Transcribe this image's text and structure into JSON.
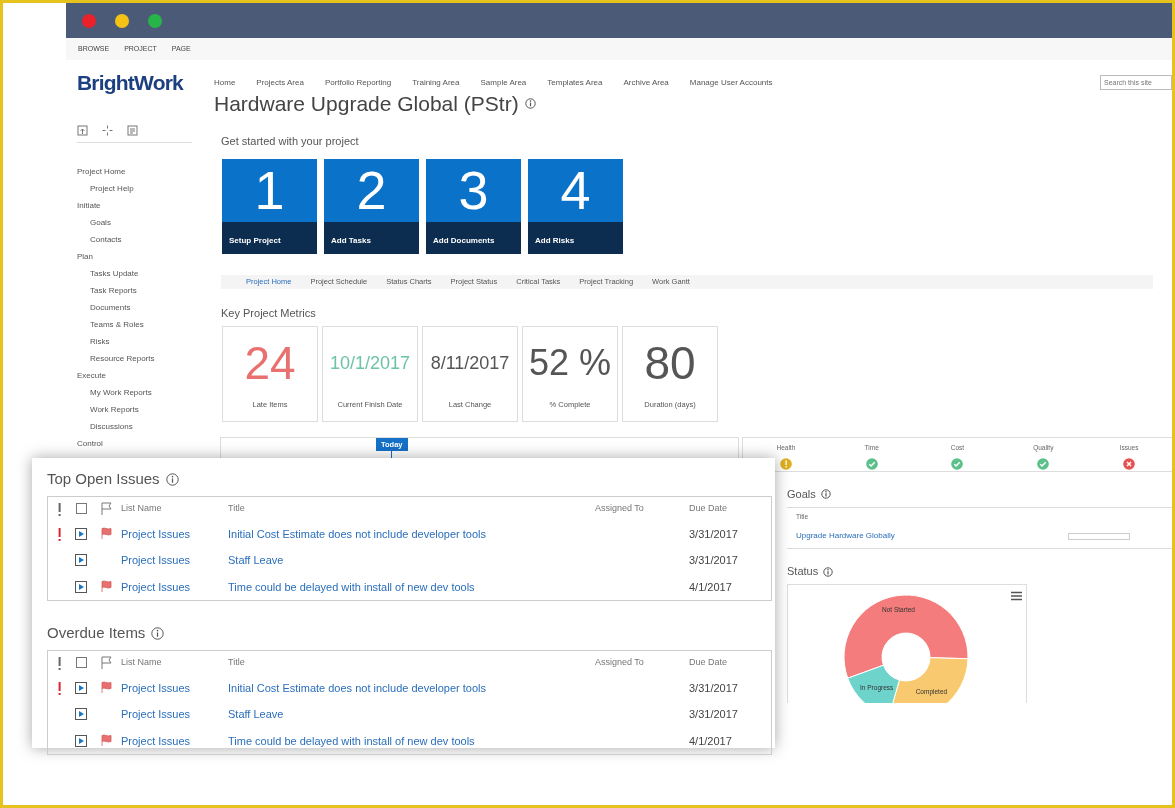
{
  "ribbon_tabs": [
    "BROWSE",
    "PROJECT",
    "PAGE"
  ],
  "logo": "BrightWork",
  "top_nav": [
    "Home",
    "Projects Area",
    "Portfolio Reporting",
    "Training Area",
    "Sample Area",
    "Templates Area",
    "Archive Area",
    "Manage User Accounts"
  ],
  "search": {
    "placeholder": "Search this site"
  },
  "title": "Hardware Upgrade Global (PStr)",
  "sidebar": {
    "items": [
      {
        "label": "Project Home",
        "children": [
          {
            "label": "Project Help"
          }
        ]
      },
      {
        "label": "Initiate",
        "children": [
          {
            "label": "Goals"
          },
          {
            "label": "Contacts"
          }
        ]
      },
      {
        "label": "Plan",
        "children": [
          {
            "label": "Tasks Update"
          },
          {
            "label": "Task Reports"
          },
          {
            "label": "Documents"
          },
          {
            "label": "Teams & Roles"
          },
          {
            "label": "Risks"
          },
          {
            "label": "Resource Reports"
          }
        ]
      },
      {
        "label": "Execute",
        "children": [
          {
            "label": "My Work Reports"
          },
          {
            "label": "Work Reports"
          },
          {
            "label": "Discussions"
          }
        ]
      },
      {
        "label": "Control"
      }
    ]
  },
  "get_started": {
    "heading": "Get started with your project",
    "tiles": [
      {
        "number": "1",
        "label": "Setup Project"
      },
      {
        "number": "2",
        "label": "Add Tasks"
      },
      {
        "number": "3",
        "label": "Add Documents"
      },
      {
        "number": "4",
        "label": "Add Risks"
      }
    ]
  },
  "page_tabs": [
    {
      "label": "Project Home",
      "selected": true
    },
    {
      "label": "Project Schedule",
      "selected": false
    },
    {
      "label": "Status Charts",
      "selected": false
    },
    {
      "label": "Project Status",
      "selected": false
    },
    {
      "label": "Critical Tasks",
      "selected": false
    },
    {
      "label": "Project Tracking",
      "selected": false
    },
    {
      "label": "Work Gantt",
      "selected": false
    }
  ],
  "metrics": {
    "heading": "Key Project Metrics",
    "items": [
      {
        "kind": "large",
        "value": "24",
        "label": "Late Items",
        "color": "#e8716f"
      },
      {
        "kind": "date",
        "value": "10/1/2017",
        "label": "Current Finish Date",
        "color": "#6cc3a5"
      },
      {
        "kind": "date",
        "value": "8/11/2017",
        "label": "Last Change",
        "color": "#555555"
      },
      {
        "kind": "medium",
        "value": "52 %",
        "label": "% Complete",
        "color": "#555555"
      },
      {
        "kind": "large",
        "value": "80",
        "label": "Duration (days)",
        "color": "#555555"
      }
    ]
  },
  "timeline": {
    "marker": "Today"
  },
  "health": [
    {
      "label": "Health",
      "kind": "warning"
    },
    {
      "label": "Time",
      "kind": "ok"
    },
    {
      "label": "Cost",
      "kind": "ok"
    },
    {
      "label": "Quality",
      "kind": "ok"
    },
    {
      "label": "Issues",
      "kind": "error"
    }
  ],
  "goals": {
    "heading": "Goals",
    "columns": [
      "Title"
    ],
    "rows": [
      {
        "title": "Upgrade Hardware Globally",
        "level": 0
      }
    ]
  },
  "status": {
    "heading": "Status",
    "slices": [
      {
        "label": "Not Started",
        "color": "#f47c7c"
      },
      {
        "label": "Completed",
        "color": "#f8c96e"
      },
      {
        "label": "In Progress",
        "color": "#6dd3cb"
      }
    ]
  },
  "panels": [
    {
      "heading": "Top Open Issues",
      "select_all_checked": false,
      "columns": [
        "List Name",
        "Title",
        "Assigned To",
        "Due Date"
      ],
      "rows": [
        {
          "high_priority": true,
          "flagged": true,
          "list_name": "Project Issues",
          "title": "Initial Cost Estimate does not include developer tools",
          "due_date": "3/31/2017"
        },
        {
          "high_priority": false,
          "flagged": false,
          "list_name": "Project Issues",
          "title": "Staff Leave",
          "due_date": "3/31/2017"
        },
        {
          "high_priority": false,
          "flagged": true,
          "list_name": "Project Issues",
          "title": "Time could be delayed with install of new dev tools",
          "due_date": "4/1/2017"
        }
      ]
    },
    {
      "heading": "Overdue Items",
      "select_all_checked": false,
      "columns": [
        "List Name",
        "Title",
        "Assigned To",
        "Due Date"
      ],
      "rows": [
        {
          "high_priority": true,
          "flagged": true,
          "list_name": "Project Issues",
          "title": "Initial Cost Estimate does not include developer tools",
          "due_date": "3/31/2017"
        },
        {
          "high_priority": false,
          "flagged": false,
          "list_name": "Project Issues",
          "title": "Staff Leave",
          "due_date": "3/31/2017"
        },
        {
          "high_priority": false,
          "flagged": true,
          "list_name": "Project Issues",
          "title": "Time could be delayed with install of new dev tools",
          "due_date": "4/1/2017"
        }
      ]
    }
  ]
}
